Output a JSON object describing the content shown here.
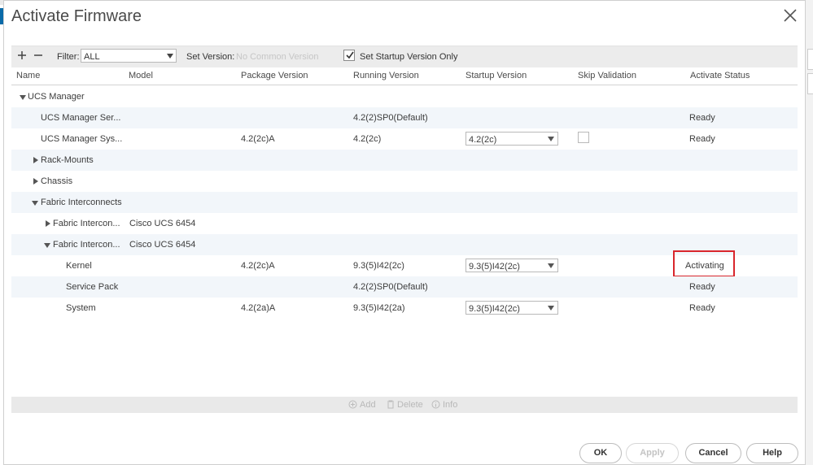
{
  "dialog": {
    "title": "Activate Firmware",
    "close_icon": "close-icon"
  },
  "toolbar": {
    "add_icon": "plus-icon",
    "remove_icon": "minus-icon",
    "filter_label": "Filter:",
    "filter_value": "ALL",
    "set_version_label": "Set Version:",
    "set_version_placeholder": "No Common Version",
    "startup_only_checked": true,
    "startup_only_label": "Set Startup Version Only"
  },
  "table": {
    "columns": [
      "Name",
      "Model",
      "Package Version",
      "Running Version",
      "Startup Version",
      "Skip Validation",
      "Activate Status"
    ],
    "rows": [
      {
        "name": "UCS Manager",
        "model": "",
        "package": "",
        "running": "",
        "startup": "",
        "status": ""
      },
      {
        "name": "UCS Manager Ser...",
        "model": "",
        "package": "",
        "running": "4.2(2)SP0(Default)",
        "startup": "",
        "status": "Ready"
      },
      {
        "name": "UCS Manager Sys...",
        "model": "",
        "package": "4.2(2c)A",
        "running": "4.2(2c)",
        "startup": "4.2(2c)",
        "status": "Ready"
      },
      {
        "name": "Rack-Mounts",
        "model": "",
        "package": "",
        "running": "",
        "startup": "",
        "status": ""
      },
      {
        "name": "Chassis",
        "model": "",
        "package": "",
        "running": "",
        "startup": "",
        "status": ""
      },
      {
        "name": "Fabric Interconnects",
        "model": "",
        "package": "",
        "running": "",
        "startup": "",
        "status": ""
      },
      {
        "name": "Fabric Intercon...",
        "model": "Cisco UCS 6454",
        "package": "",
        "running": "",
        "startup": "",
        "status": ""
      },
      {
        "name": "Fabric Intercon...",
        "model": "Cisco UCS 6454",
        "package": "",
        "running": "",
        "startup": "",
        "status": ""
      },
      {
        "name": "Kernel",
        "model": "",
        "package": "4.2(2c)A",
        "running": "9.3(5)I42(2c)",
        "startup": "9.3(5)I42(2c)",
        "status": "Activating"
      },
      {
        "name": "Service Pack",
        "model": "",
        "package": "",
        "running": "4.2(2)SP0(Default)",
        "startup": "",
        "status": "Ready"
      },
      {
        "name": "System",
        "model": "",
        "package": "4.2(2a)A",
        "running": "9.3(5)I42(2a)",
        "startup": "9.3(5)I42(2c)",
        "status": "Ready"
      }
    ]
  },
  "bottombar": {
    "add_label": "Add",
    "delete_label": "Delete",
    "info_label": "Info"
  },
  "buttons": {
    "ok": "OK",
    "apply": "Apply",
    "cancel": "Cancel",
    "help": "Help"
  },
  "colors": {
    "highlight": "#d9262c",
    "row_alt": "#f2f6fa",
    "toolbar_bg": "#ececec"
  }
}
